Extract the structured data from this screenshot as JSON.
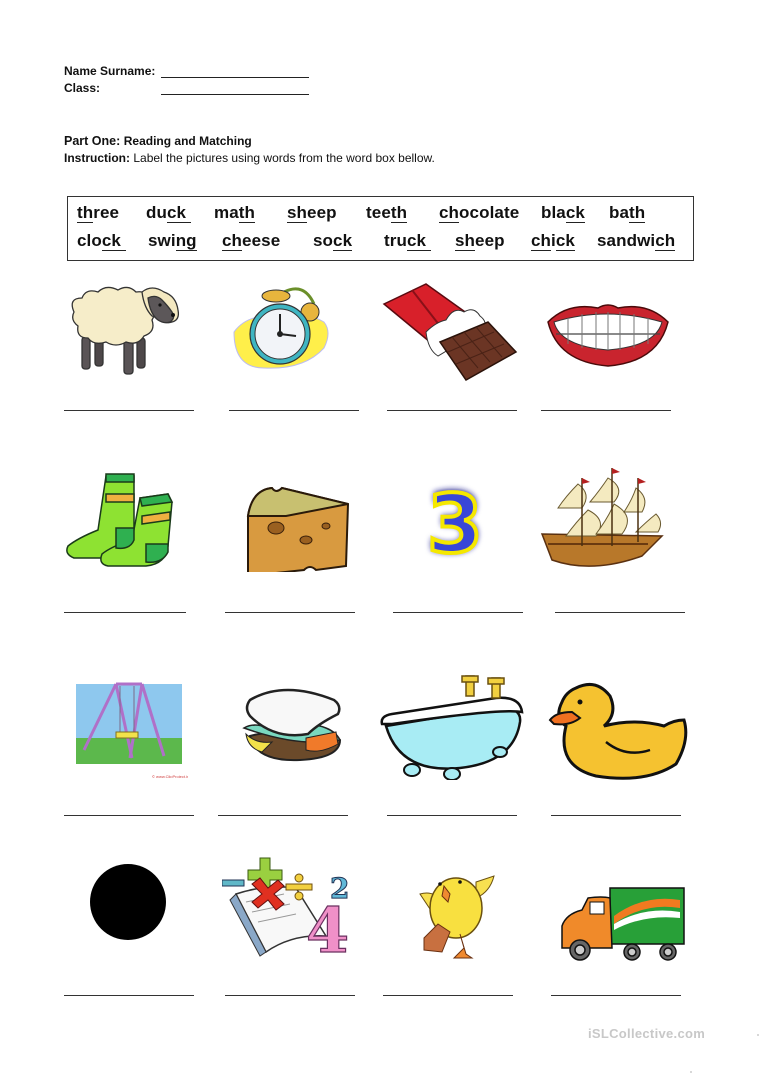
{
  "header": {
    "name_label": "Name Surname:",
    "class_label": "Class:"
  },
  "part": {
    "title_bold": "Part One:",
    "title_rest": "Reading and Matching",
    "instruction_label": "Instruction:",
    "instruction_text": "Label the pictures using words from the word box bellow."
  },
  "word_box": {
    "row1": [
      {
        "pre": "",
        "u": "th",
        "post": "ree"
      },
      {
        "pre": "du",
        "u": "ck ",
        "post": ""
      },
      {
        "pre": "ma",
        "u": "th",
        "post": ""
      },
      {
        "pre": "",
        "u": "sh",
        "post": "eep"
      },
      {
        "pre": "tee",
        "u": "th",
        "post": ""
      },
      {
        "pre": "",
        "u": "ch",
        "post": "ocolate"
      },
      {
        "pre": "bla",
        "u": "ck",
        "post": ""
      },
      {
        "pre": "ba",
        "u": "th",
        "post": ""
      }
    ],
    "row2": [
      {
        "pre": "clo",
        "u": "ck ",
        "post": ""
      },
      {
        "pre": "swi",
        "u": "ng",
        "post": ""
      },
      {
        "pre": "",
        "u": "ch",
        "post": "eese"
      },
      {
        "pre": "so",
        "u": "ck",
        "post": ""
      },
      {
        "pre": "tru",
        "u": "ck ",
        "post": ""
      },
      {
        "pre": "",
        "u": "sh",
        "post": "eep"
      },
      {
        "pre": "",
        "u": "ch",
        "post": "i",
        "u2": "ck"
      },
      {
        "pre": "sandwi",
        "u": "ch",
        "post": ""
      }
    ]
  },
  "pictures": [
    {
      "row": 1,
      "col": 1,
      "subject": "sheep"
    },
    {
      "row": 1,
      "col": 2,
      "subject": "alarm clock"
    },
    {
      "row": 1,
      "col": 3,
      "subject": "chocolate bar"
    },
    {
      "row": 1,
      "col": 4,
      "subject": "teeth"
    },
    {
      "row": 2,
      "col": 1,
      "subject": "socks"
    },
    {
      "row": 2,
      "col": 2,
      "subject": "cheese"
    },
    {
      "row": 2,
      "col": 3,
      "subject": "number three"
    },
    {
      "row": 2,
      "col": 4,
      "subject": "ship"
    },
    {
      "row": 3,
      "col": 1,
      "subject": "swing"
    },
    {
      "row": 3,
      "col": 2,
      "subject": "sandwich"
    },
    {
      "row": 3,
      "col": 3,
      "subject": "bathtub"
    },
    {
      "row": 3,
      "col": 4,
      "subject": "duck"
    },
    {
      "row": 4,
      "col": 1,
      "subject": "black circle"
    },
    {
      "row": 4,
      "col": 2,
      "subject": "math book"
    },
    {
      "row": 4,
      "col": 3,
      "subject": "chick"
    },
    {
      "row": 4,
      "col": 4,
      "subject": "truck"
    }
  ],
  "footer": {
    "watermark": "iSLCollective.com"
  },
  "colors": {
    "text": "#111111",
    "watermark": "#c8c8c8"
  }
}
